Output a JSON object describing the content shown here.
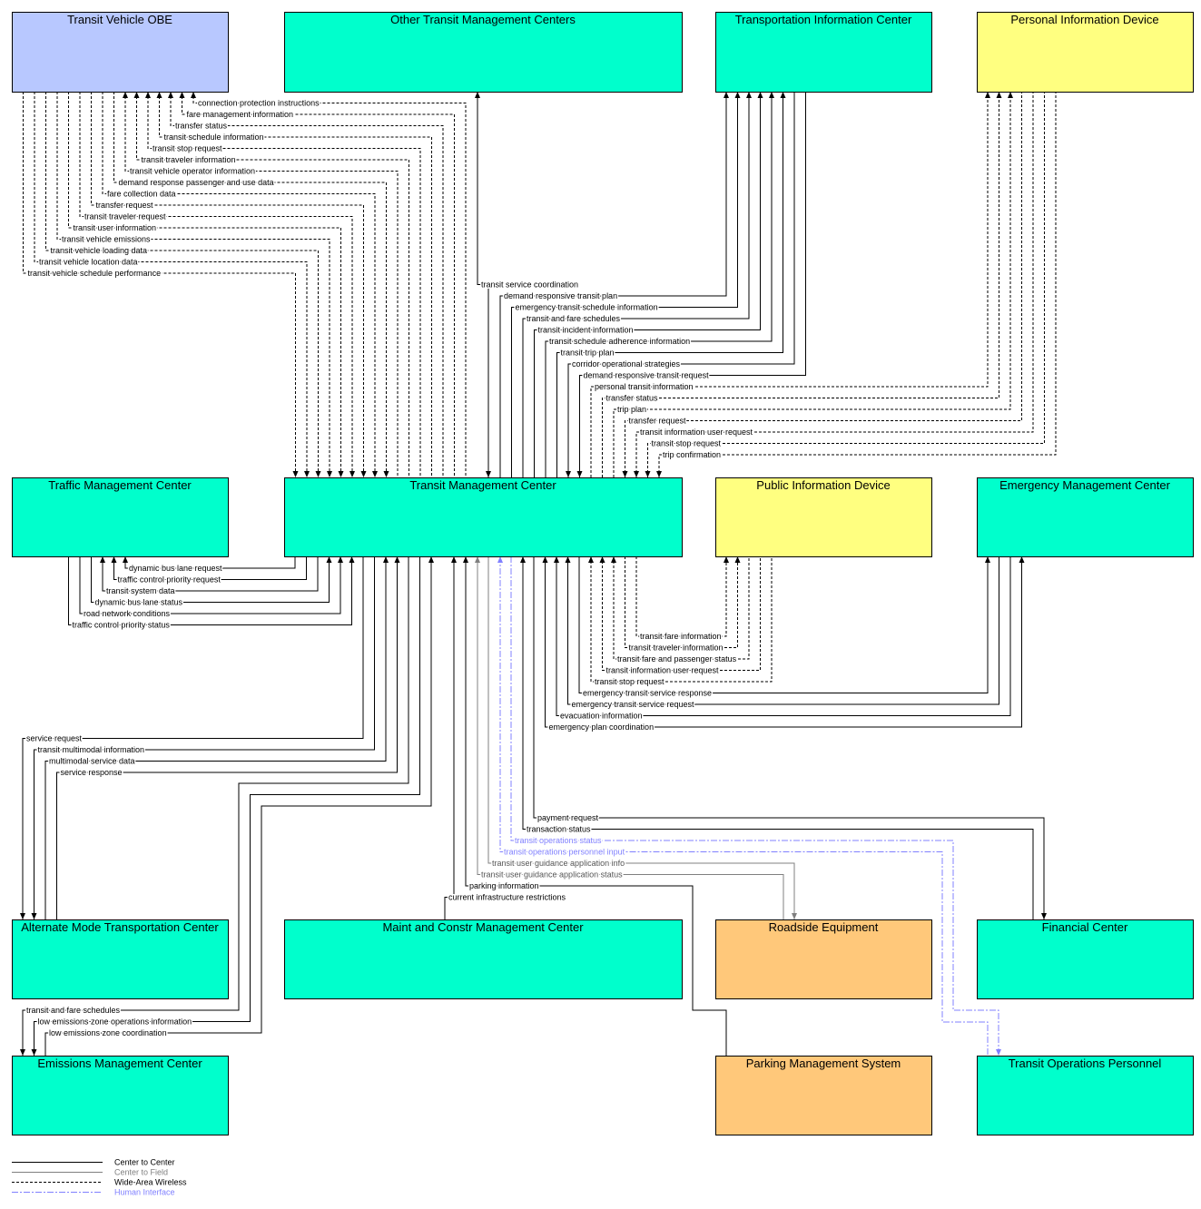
{
  "colors": {
    "center": "#00ffcc",
    "vehicle": "#b8c8ff",
    "traveler": "#ffff80",
    "field": "#ffc87a",
    "center_to_center": "#000000",
    "center_to_field": "#808080",
    "wide_area_wireless": "#000000",
    "human_interface": "#8080ff"
  },
  "boxes": [
    {
      "id": "obe",
      "label": "Transit Vehicle OBE",
      "kind": "vehicle"
    },
    {
      "id": "otmc",
      "label": "Other Transit Management Centers",
      "kind": "center"
    },
    {
      "id": "tic",
      "label": "Transportation Information Center",
      "kind": "center"
    },
    {
      "id": "pid",
      "label": "Personal Information Device",
      "kind": "traveler"
    },
    {
      "id": "trafmc",
      "label": "Traffic Management Center",
      "kind": "center"
    },
    {
      "id": "tmc",
      "label": "Transit Management Center",
      "kind": "center"
    },
    {
      "id": "pubid",
      "label": "Public Information Device",
      "kind": "traveler"
    },
    {
      "id": "emc",
      "label": "Emergency Management Center",
      "kind": "center"
    },
    {
      "id": "alt",
      "label": "Alternate Mode Transportation Center",
      "kind": "center"
    },
    {
      "id": "maint",
      "label": "Maint and Constr Management Center",
      "kind": "center"
    },
    {
      "id": "rse",
      "label": "Roadside Equipment",
      "kind": "field"
    },
    {
      "id": "fin",
      "label": "Financial Center",
      "kind": "center"
    },
    {
      "id": "emis",
      "label": "Emissions Management Center",
      "kind": "center"
    },
    {
      "id": "park",
      "label": "Parking Management System",
      "kind": "field"
    },
    {
      "id": "top",
      "label": "Transit Operations Personnel",
      "kind": "center"
    }
  ],
  "flows": [
    {
      "label": "connection protection instructions",
      "type": "wide_area_wireless"
    },
    {
      "label": "fare management information",
      "type": "wide_area_wireless"
    },
    {
      "label": "transfer status",
      "type": "wide_area_wireless"
    },
    {
      "label": "transit schedule information",
      "type": "wide_area_wireless"
    },
    {
      "label": "transit stop request",
      "type": "wide_area_wireless"
    },
    {
      "label": "transit traveler information",
      "type": "wide_area_wireless"
    },
    {
      "label": "transit vehicle operator information",
      "type": "wide_area_wireless"
    },
    {
      "label": "demand response passenger and use data",
      "type": "wide_area_wireless"
    },
    {
      "label": "fare collection data",
      "type": "wide_area_wireless"
    },
    {
      "label": "transfer request",
      "type": "wide_area_wireless"
    },
    {
      "label": "transit traveler request",
      "type": "wide_area_wireless"
    },
    {
      "label": "transit user information",
      "type": "wide_area_wireless"
    },
    {
      "label": "transit vehicle emissions",
      "type": "wide_area_wireless"
    },
    {
      "label": "transit vehicle loading data",
      "type": "wide_area_wireless"
    },
    {
      "label": "transit vehicle location data",
      "type": "wide_area_wireless"
    },
    {
      "label": "transit vehicle schedule performance",
      "type": "wide_area_wireless"
    },
    {
      "label": "transit service coordination",
      "type": "center_to_center"
    },
    {
      "label": "demand responsive transit plan",
      "type": "center_to_center"
    },
    {
      "label": "emergency transit schedule information",
      "type": "center_to_center"
    },
    {
      "label": "transit and fare schedules",
      "type": "center_to_center"
    },
    {
      "label": "transit incident information",
      "type": "center_to_center"
    },
    {
      "label": "transit schedule adherence information",
      "type": "center_to_center"
    },
    {
      "label": "transit trip plan",
      "type": "center_to_center"
    },
    {
      "label": "corridor operational strategies",
      "type": "center_to_center"
    },
    {
      "label": "demand responsive transit request",
      "type": "center_to_center"
    },
    {
      "label": "personal transit information",
      "type": "wide_area_wireless"
    },
    {
      "label": "transfer status",
      "type": "wide_area_wireless"
    },
    {
      "label": "trip plan",
      "type": "wide_area_wireless"
    },
    {
      "label": "transfer request",
      "type": "wide_area_wireless"
    },
    {
      "label": "transit information user request",
      "type": "wide_area_wireless"
    },
    {
      "label": "transit stop request",
      "type": "wide_area_wireless"
    },
    {
      "label": "trip confirmation",
      "type": "wide_area_wireless"
    },
    {
      "label": "dynamic bus lane request",
      "type": "center_to_center"
    },
    {
      "label": "traffic control priority request",
      "type": "center_to_center"
    },
    {
      "label": "transit system data",
      "type": "center_to_center"
    },
    {
      "label": "dynamic bus lane status",
      "type": "center_to_center"
    },
    {
      "label": "road network conditions",
      "type": "center_to_center"
    },
    {
      "label": "traffic control priority status",
      "type": "center_to_center"
    },
    {
      "label": "service request",
      "type": "center_to_center"
    },
    {
      "label": "transit multimodal information",
      "type": "center_to_center"
    },
    {
      "label": "multimodal service data",
      "type": "center_to_center"
    },
    {
      "label": "service response",
      "type": "center_to_center"
    },
    {
      "label": "transit and fare schedules",
      "type": "center_to_center"
    },
    {
      "label": "low emissions zone operations information",
      "type": "center_to_center"
    },
    {
      "label": "low emissions zone coordination",
      "type": "center_to_center"
    },
    {
      "label": "current infrastructure restrictions",
      "type": "center_to_center"
    },
    {
      "label": "parking information",
      "type": "center_to_center"
    },
    {
      "label": "transit user guidance application info",
      "type": "center_to_field"
    },
    {
      "label": "transit user guidance application status",
      "type": "center_to_field"
    },
    {
      "label": "transit operations status",
      "type": "human_interface"
    },
    {
      "label": "transit operations personnel input",
      "type": "human_interface"
    },
    {
      "label": "payment request",
      "type": "center_to_center"
    },
    {
      "label": "transaction status",
      "type": "center_to_center"
    },
    {
      "label": "transit fare information",
      "type": "wide_area_wireless"
    },
    {
      "label": "transit traveler information",
      "type": "wide_area_wireless"
    },
    {
      "label": "transit fare and passenger status",
      "type": "wide_area_wireless"
    },
    {
      "label": "transit information user request",
      "type": "wide_area_wireless"
    },
    {
      "label": "transit stop request",
      "type": "wide_area_wireless"
    },
    {
      "label": "emergency transit service response",
      "type": "center_to_center"
    },
    {
      "label": "emergency transit service request",
      "type": "center_to_center"
    },
    {
      "label": "evacuation information",
      "type": "center_to_center"
    },
    {
      "label": "emergency plan coordination",
      "type": "center_to_center"
    }
  ],
  "legend": [
    {
      "label": "Center to Center",
      "type": "center_to_center"
    },
    {
      "label": "Center to Field",
      "type": "center_to_field"
    },
    {
      "label": "Wide-Area Wireless",
      "type": "wide_area_wireless"
    },
    {
      "label": "Human Interface",
      "type": "human_interface"
    }
  ]
}
